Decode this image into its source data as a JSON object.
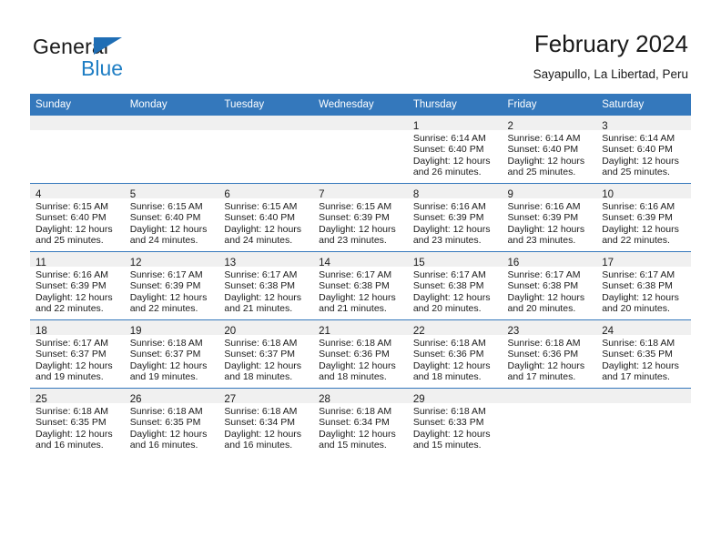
{
  "brand": {
    "name_top": "General",
    "name_bottom": "Blue",
    "triangle_color": "#1f6eb5",
    "blue_text_color": "#1f7ec4"
  },
  "header": {
    "title": "February 2024",
    "subtitle": "Sayapullo, La Libertad, Peru"
  },
  "theme": {
    "header_bg": "#3478bc",
    "header_text": "#ffffff",
    "daystrip_bg": "#f0f0f0",
    "cell_bg": "#ffffff",
    "rule_color": "#3478bc"
  },
  "weekday_headers": [
    "Sunday",
    "Monday",
    "Tuesday",
    "Wednesday",
    "Thursday",
    "Friday",
    "Saturday"
  ],
  "labels": {
    "sunrise_prefix": "Sunrise:",
    "sunset_prefix": "Sunset:",
    "daylight_prefix": "Daylight:"
  },
  "weeks": [
    [
      {
        "empty": true
      },
      {
        "empty": true
      },
      {
        "empty": true
      },
      {
        "empty": true
      },
      {
        "day": "1",
        "sunrise": "Sunrise: 6:14 AM",
        "sunset": "Sunset: 6:40 PM",
        "daylight1": "Daylight: 12 hours",
        "daylight2": "and 26 minutes."
      },
      {
        "day": "2",
        "sunrise": "Sunrise: 6:14 AM",
        "sunset": "Sunset: 6:40 PM",
        "daylight1": "Daylight: 12 hours",
        "daylight2": "and 25 minutes."
      },
      {
        "day": "3",
        "sunrise": "Sunrise: 6:14 AM",
        "sunset": "Sunset: 6:40 PM",
        "daylight1": "Daylight: 12 hours",
        "daylight2": "and 25 minutes."
      }
    ],
    [
      {
        "day": "4",
        "sunrise": "Sunrise: 6:15 AM",
        "sunset": "Sunset: 6:40 PM",
        "daylight1": "Daylight: 12 hours",
        "daylight2": "and 25 minutes."
      },
      {
        "day": "5",
        "sunrise": "Sunrise: 6:15 AM",
        "sunset": "Sunset: 6:40 PM",
        "daylight1": "Daylight: 12 hours",
        "daylight2": "and 24 minutes."
      },
      {
        "day": "6",
        "sunrise": "Sunrise: 6:15 AM",
        "sunset": "Sunset: 6:40 PM",
        "daylight1": "Daylight: 12 hours",
        "daylight2": "and 24 minutes."
      },
      {
        "day": "7",
        "sunrise": "Sunrise: 6:15 AM",
        "sunset": "Sunset: 6:39 PM",
        "daylight1": "Daylight: 12 hours",
        "daylight2": "and 23 minutes."
      },
      {
        "day": "8",
        "sunrise": "Sunrise: 6:16 AM",
        "sunset": "Sunset: 6:39 PM",
        "daylight1": "Daylight: 12 hours",
        "daylight2": "and 23 minutes."
      },
      {
        "day": "9",
        "sunrise": "Sunrise: 6:16 AM",
        "sunset": "Sunset: 6:39 PM",
        "daylight1": "Daylight: 12 hours",
        "daylight2": "and 23 minutes."
      },
      {
        "day": "10",
        "sunrise": "Sunrise: 6:16 AM",
        "sunset": "Sunset: 6:39 PM",
        "daylight1": "Daylight: 12 hours",
        "daylight2": "and 22 minutes."
      }
    ],
    [
      {
        "day": "11",
        "sunrise": "Sunrise: 6:16 AM",
        "sunset": "Sunset: 6:39 PM",
        "daylight1": "Daylight: 12 hours",
        "daylight2": "and 22 minutes."
      },
      {
        "day": "12",
        "sunrise": "Sunrise: 6:17 AM",
        "sunset": "Sunset: 6:39 PM",
        "daylight1": "Daylight: 12 hours",
        "daylight2": "and 22 minutes."
      },
      {
        "day": "13",
        "sunrise": "Sunrise: 6:17 AM",
        "sunset": "Sunset: 6:38 PM",
        "daylight1": "Daylight: 12 hours",
        "daylight2": "and 21 minutes."
      },
      {
        "day": "14",
        "sunrise": "Sunrise: 6:17 AM",
        "sunset": "Sunset: 6:38 PM",
        "daylight1": "Daylight: 12 hours",
        "daylight2": "and 21 minutes."
      },
      {
        "day": "15",
        "sunrise": "Sunrise: 6:17 AM",
        "sunset": "Sunset: 6:38 PM",
        "daylight1": "Daylight: 12 hours",
        "daylight2": "and 20 minutes."
      },
      {
        "day": "16",
        "sunrise": "Sunrise: 6:17 AM",
        "sunset": "Sunset: 6:38 PM",
        "daylight1": "Daylight: 12 hours",
        "daylight2": "and 20 minutes."
      },
      {
        "day": "17",
        "sunrise": "Sunrise: 6:17 AM",
        "sunset": "Sunset: 6:38 PM",
        "daylight1": "Daylight: 12 hours",
        "daylight2": "and 20 minutes."
      }
    ],
    [
      {
        "day": "18",
        "sunrise": "Sunrise: 6:17 AM",
        "sunset": "Sunset: 6:37 PM",
        "daylight1": "Daylight: 12 hours",
        "daylight2": "and 19 minutes."
      },
      {
        "day": "19",
        "sunrise": "Sunrise: 6:18 AM",
        "sunset": "Sunset: 6:37 PM",
        "daylight1": "Daylight: 12 hours",
        "daylight2": "and 19 minutes."
      },
      {
        "day": "20",
        "sunrise": "Sunrise: 6:18 AM",
        "sunset": "Sunset: 6:37 PM",
        "daylight1": "Daylight: 12 hours",
        "daylight2": "and 18 minutes."
      },
      {
        "day": "21",
        "sunrise": "Sunrise: 6:18 AM",
        "sunset": "Sunset: 6:36 PM",
        "daylight1": "Daylight: 12 hours",
        "daylight2": "and 18 minutes."
      },
      {
        "day": "22",
        "sunrise": "Sunrise: 6:18 AM",
        "sunset": "Sunset: 6:36 PM",
        "daylight1": "Daylight: 12 hours",
        "daylight2": "and 18 minutes."
      },
      {
        "day": "23",
        "sunrise": "Sunrise: 6:18 AM",
        "sunset": "Sunset: 6:36 PM",
        "daylight1": "Daylight: 12 hours",
        "daylight2": "and 17 minutes."
      },
      {
        "day": "24",
        "sunrise": "Sunrise: 6:18 AM",
        "sunset": "Sunset: 6:35 PM",
        "daylight1": "Daylight: 12 hours",
        "daylight2": "and 17 minutes."
      }
    ],
    [
      {
        "day": "25",
        "sunrise": "Sunrise: 6:18 AM",
        "sunset": "Sunset: 6:35 PM",
        "daylight1": "Daylight: 12 hours",
        "daylight2": "and 16 minutes."
      },
      {
        "day": "26",
        "sunrise": "Sunrise: 6:18 AM",
        "sunset": "Sunset: 6:35 PM",
        "daylight1": "Daylight: 12 hours",
        "daylight2": "and 16 minutes."
      },
      {
        "day": "27",
        "sunrise": "Sunrise: 6:18 AM",
        "sunset": "Sunset: 6:34 PM",
        "daylight1": "Daylight: 12 hours",
        "daylight2": "and 16 minutes."
      },
      {
        "day": "28",
        "sunrise": "Sunrise: 6:18 AM",
        "sunset": "Sunset: 6:34 PM",
        "daylight1": "Daylight: 12 hours",
        "daylight2": "and 15 minutes."
      },
      {
        "day": "29",
        "sunrise": "Sunrise: 6:18 AM",
        "sunset": "Sunset: 6:33 PM",
        "daylight1": "Daylight: 12 hours",
        "daylight2": "and 15 minutes."
      },
      {
        "empty": true
      },
      {
        "empty": true
      }
    ]
  ]
}
